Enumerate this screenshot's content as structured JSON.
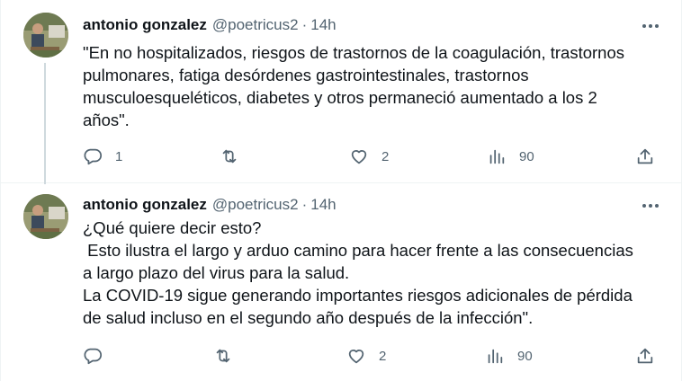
{
  "tweets": [
    {
      "author": {
        "name": "antonio gonzalez",
        "handle": "@poetricus2"
      },
      "separator": "·",
      "time": "14h",
      "text": "\"En no hospitalizados, riesgos de trastornos de la coagulación, trastornos\npulmonares, fatiga desórdenes gastrointestinales, trastornos\nmusculoesqueléticos, diabetes y otros permaneció aumentado a los 2\naños\".",
      "metrics": {
        "replies": "1",
        "retweets": "",
        "likes": "2",
        "views": "90"
      }
    },
    {
      "author": {
        "name": "antonio gonzalez",
        "handle": "@poetricus2"
      },
      "separator": "·",
      "time": "14h",
      "text": "¿Qué quiere decir esto?\n Esto ilustra el largo y arduo camino para hacer frente a las consecuencias\na largo plazo del virus para la salud.\nLa COVID-19 sigue generando importantes riesgos adicionales de pérdida\nde salud incluso en el segundo año después de la infección\".",
      "metrics": {
        "replies": "",
        "retweets": "",
        "likes": "2",
        "views": "90"
      }
    }
  ],
  "icons": [
    "avatar",
    "more-icon",
    "reply-icon",
    "retweet-icon",
    "like-icon",
    "views-icon",
    "share-icon"
  ],
  "colors": {
    "text": "#0f1419",
    "secondary": "#536471",
    "divider": "#eff3f4",
    "thread_line": "#cfd9de"
  }
}
